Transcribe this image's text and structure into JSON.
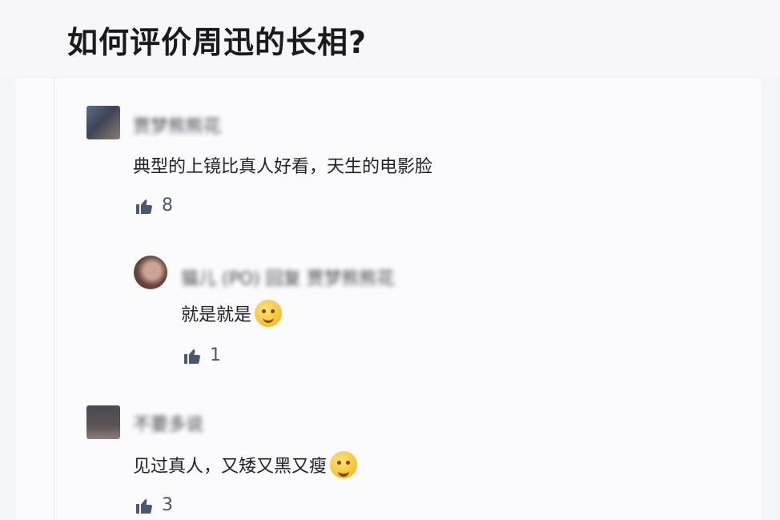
{
  "question": {
    "title": "如何评价周迅的长相?"
  },
  "comments": [
    {
      "username": "贾梦熊熊花",
      "text": "典型的上镜比真人好看，天生的电影脸",
      "likes": "8",
      "emoji": ""
    },
    {
      "username": "猫儿 (PO) 回复 贾梦熊熊花",
      "text": "就是就是",
      "likes": "1",
      "emoji": "smile-emoji"
    },
    {
      "username": "不要多说",
      "text": "见过真人，又矮又黑又瘦",
      "likes": "3",
      "emoji": "laugh-emoji"
    }
  ],
  "icons": {
    "like": "thumbs-up-icon"
  },
  "colors": {
    "like": "#4b5671",
    "background": "#f4f5f9"
  }
}
